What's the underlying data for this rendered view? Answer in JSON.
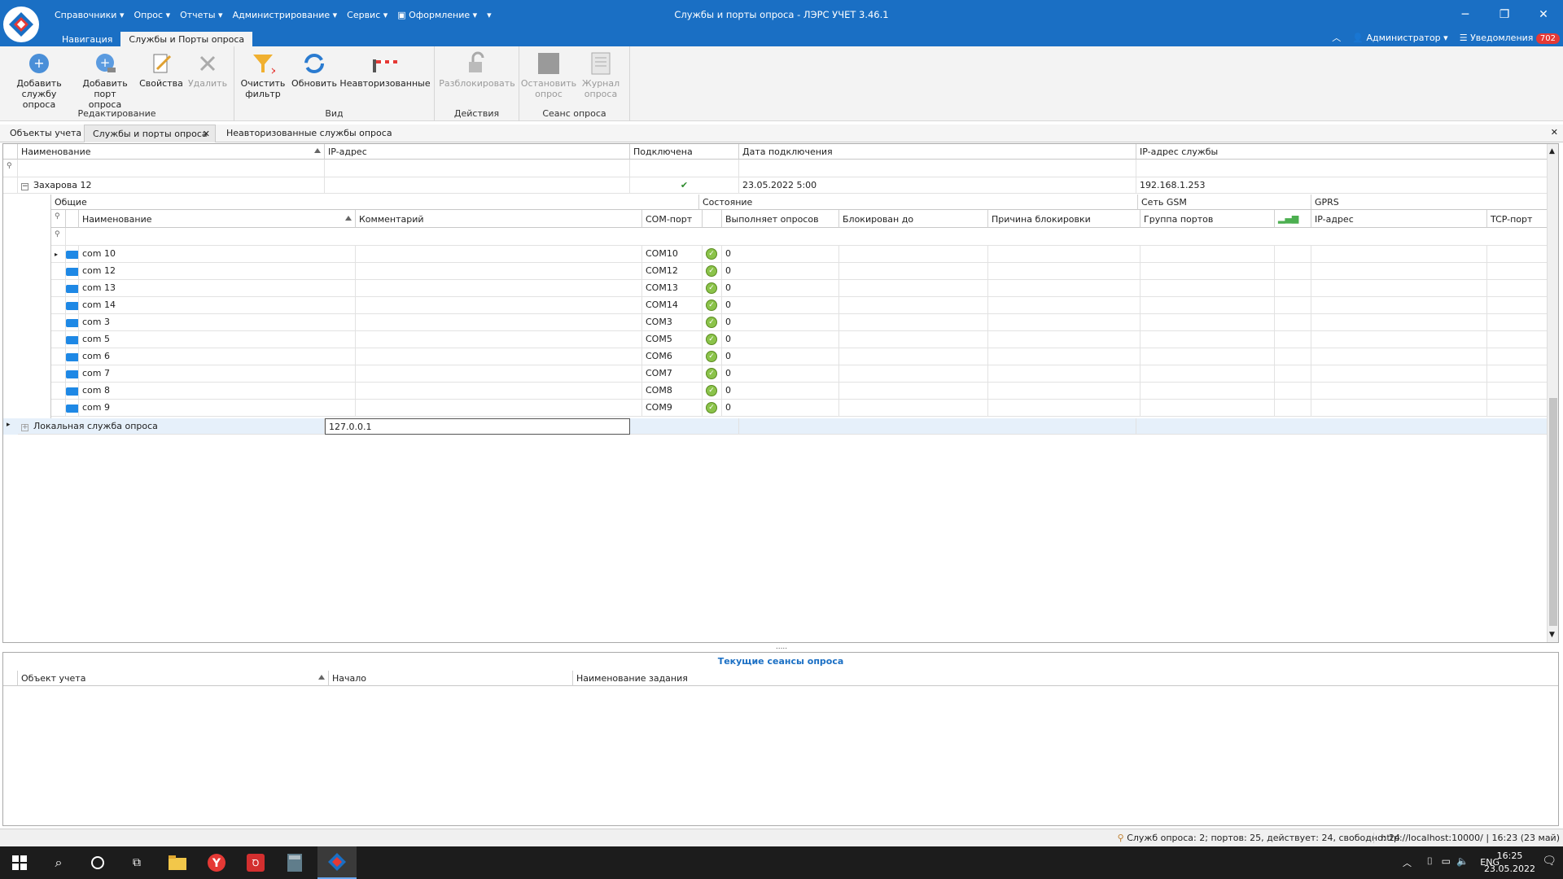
{
  "app": {
    "title": "Службы и порты опроса - ЛЭРС УЧЕТ 3.46.1",
    "menu": [
      "Справочники ▾",
      "Опрос ▾",
      "Отчеты ▾",
      "Администрирование ▾",
      "Сервис ▾",
      "Оформление ▾",
      "▾"
    ],
    "ribbon_tabs": [
      "Навигация",
      "Службы и Порты опроса"
    ],
    "user": "Администратор ▾",
    "notifications_label": "Уведомления",
    "notifications_count": "702"
  },
  "ribbon": {
    "add_service": "Добавить службу опроса",
    "add_port": "Добавить порт опроса",
    "properties": "Свойства",
    "delete": "Удалить",
    "group_edit": "Редактирование",
    "clear_filter": "Очистить фильтр",
    "refresh": "Обновить",
    "unauthorized": "Неавторизованные",
    "group_view": "Вид",
    "unlock": "Разблокировать",
    "group_actions": "Действия",
    "stop_poll": "Остановить опрос",
    "poll_log": "Журнал опроса",
    "group_session": "Сеанс опроса"
  },
  "doc_tabs": [
    "Объекты учета",
    "Службы и порты опроса",
    "Неавторизованные службы опроса"
  ],
  "grid": {
    "headers": [
      "Наименование",
      "IP-адрес",
      "Подключена",
      "Дата подключения",
      "IP-адрес службы"
    ],
    "service1": {
      "name": "Захарова 12",
      "connected": "✔",
      "date": "23.05.2022 5:00",
      "ip": "192.168.1.253"
    },
    "band_headers": [
      "Общие",
      "Состояние",
      "Сеть GSM",
      "GPRS"
    ],
    "sub_headers": [
      "Наименование",
      "Комментарий",
      "COM-порт",
      "Выполняет опросов",
      "Блокирован до",
      "Причина блокировки",
      "Группа портов",
      "IP-адрес",
      "TCP-порт"
    ],
    "ports": [
      {
        "name": "com 10",
        "com": "COM10",
        "polls": "0"
      },
      {
        "name": "com 12",
        "com": "COM12",
        "polls": "0"
      },
      {
        "name": "com 13",
        "com": "COM13",
        "polls": "0"
      },
      {
        "name": "com 14",
        "com": "COM14",
        "polls": "0"
      },
      {
        "name": "com 3",
        "com": "COM3",
        "polls": "0"
      },
      {
        "name": "com 5",
        "com": "COM5",
        "polls": "0"
      },
      {
        "name": "com 6",
        "com": "COM6",
        "polls": "0"
      },
      {
        "name": "com 7",
        "com": "COM7",
        "polls": "0"
      },
      {
        "name": "com 8",
        "com": "COM8",
        "polls": "0"
      },
      {
        "name": "com 9",
        "com": "COM9",
        "polls": "0"
      }
    ],
    "service2": {
      "name": "Локальная служба опроса",
      "ip": "127.0.0.1"
    }
  },
  "lower": {
    "title": "Текущие сеансы опроса",
    "headers": [
      "Объект учета",
      "Начало",
      "Наименование задания"
    ]
  },
  "status": {
    "text": "Служб опроса: 2; портов: 25, действует: 24, свободно: 24",
    "url": "http://localhost:10000/ | 16:23 (23 май)"
  },
  "taskbar": {
    "lang": "ENG",
    "time": "16:25",
    "date": "23.05.2022"
  }
}
